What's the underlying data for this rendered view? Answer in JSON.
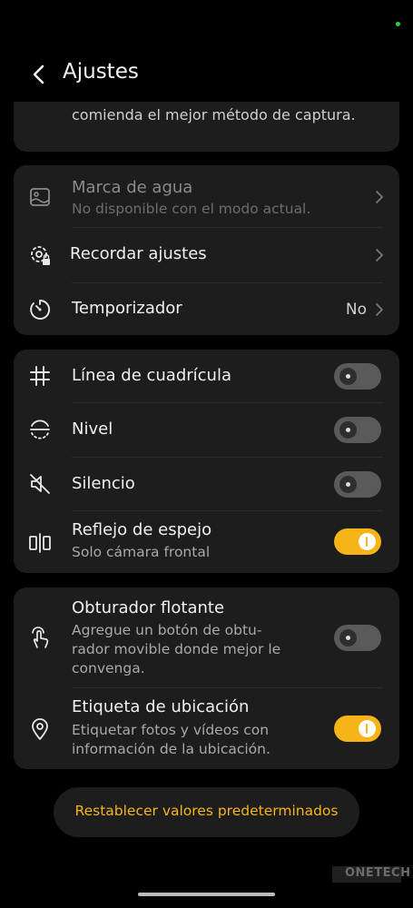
{
  "header": {
    "title": "Ajustes"
  },
  "top_card": {
    "text": "comienda el mejor método de captura."
  },
  "group1": {
    "watermark": {
      "label": "Marca de agua",
      "sub": "No disponible con el modo actual."
    },
    "remember": {
      "label": "Recordar ajustes"
    },
    "timer": {
      "label": "Temporizador",
      "value": "No"
    }
  },
  "group2": {
    "grid": {
      "label": "Línea de cuadrícula",
      "on": false
    },
    "level": {
      "label": "Nivel",
      "on": false
    },
    "mute": {
      "label": "Silencio",
      "on": false
    },
    "mirror": {
      "label": "Reflejo de espejo",
      "sub": "Solo cámara frontal",
      "on": true
    }
  },
  "group3": {
    "floating": {
      "label": "Obturador flotante",
      "sub": "Agregue un botón de obtu-rador movible donde mejor le convenga.",
      "on": false
    },
    "location": {
      "label": "Etiqueta de ubicación",
      "sub": "Etiquetar fotos y vídeos con información de la ubicación.",
      "on": true
    }
  },
  "reset_button": {
    "label": "Restablecer valores predeterminados"
  },
  "watermark_logo": {
    "text": "ONETECH"
  },
  "colors": {
    "accent": "#f6b419",
    "card": "#1d1d1d",
    "background": "#000000"
  }
}
